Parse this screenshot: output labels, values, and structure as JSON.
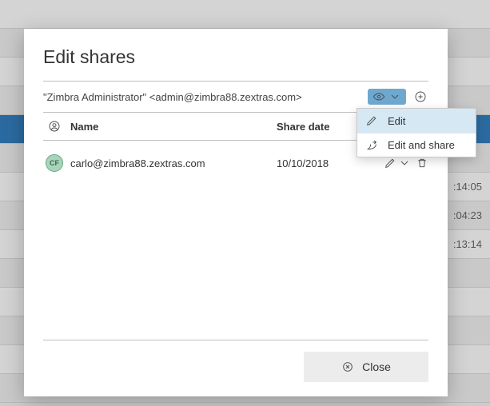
{
  "dialog": {
    "title": "Edit shares",
    "target_label": "\"Zimbra Administrator\" <admin@zimbra88.zextras.com>",
    "permission_icon": "eye-icon",
    "columns": {
      "name": "Name",
      "date": "Share date"
    },
    "rows": [
      {
        "initials": "CF",
        "email": "carlo@zimbra88.zextras.com",
        "date": "10/10/2018"
      }
    ],
    "close_label": "Close"
  },
  "dropdown": {
    "edit": "Edit",
    "edit_share": "Edit and share"
  },
  "background_times": [
    "‌:14:05",
    "‌:04:23",
    "‌:13:14"
  ]
}
